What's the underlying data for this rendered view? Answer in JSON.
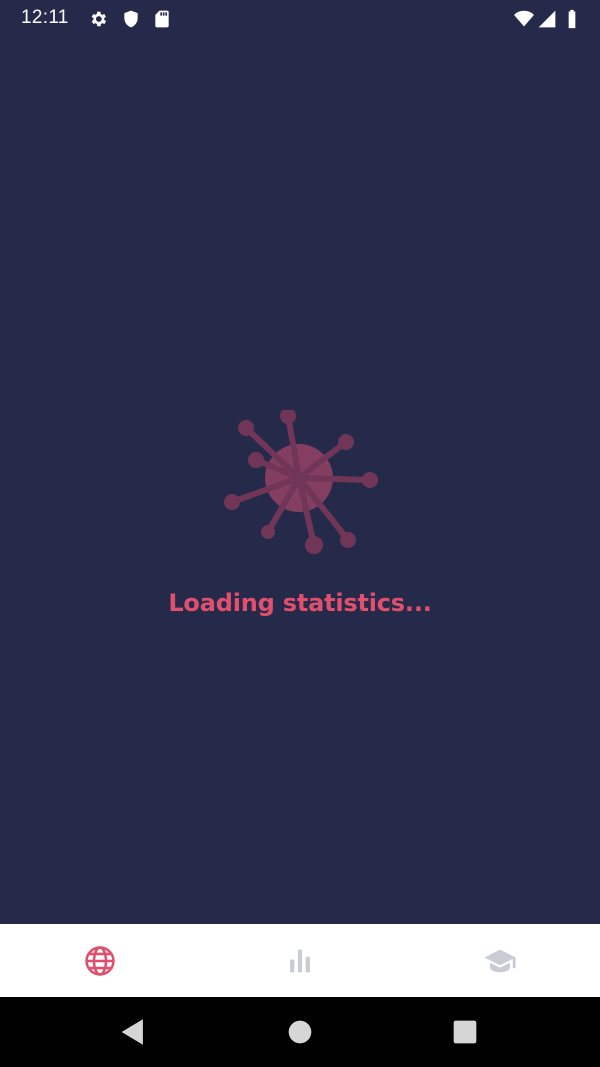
{
  "status_bar": {
    "time": "12:11",
    "icons": [
      "gear-icon",
      "shield-icon",
      "sd-card-icon",
      "wifi-icon",
      "signal-icon",
      "battery-icon"
    ]
  },
  "main": {
    "loading_text": "Loading statistics...",
    "accent_color": "#e0506e",
    "background_color": "#262a4a"
  },
  "bottom_nav": {
    "items": [
      {
        "icon": "globe-icon",
        "active": true
      },
      {
        "icon": "bar-chart-icon",
        "active": false
      },
      {
        "icon": "graduation-cap-icon",
        "active": false
      }
    ],
    "active_color": "#e0506e",
    "inactive_color": "#c9ccd4"
  },
  "system_nav": {
    "buttons": [
      "back-icon",
      "home-icon",
      "recents-icon"
    ]
  }
}
